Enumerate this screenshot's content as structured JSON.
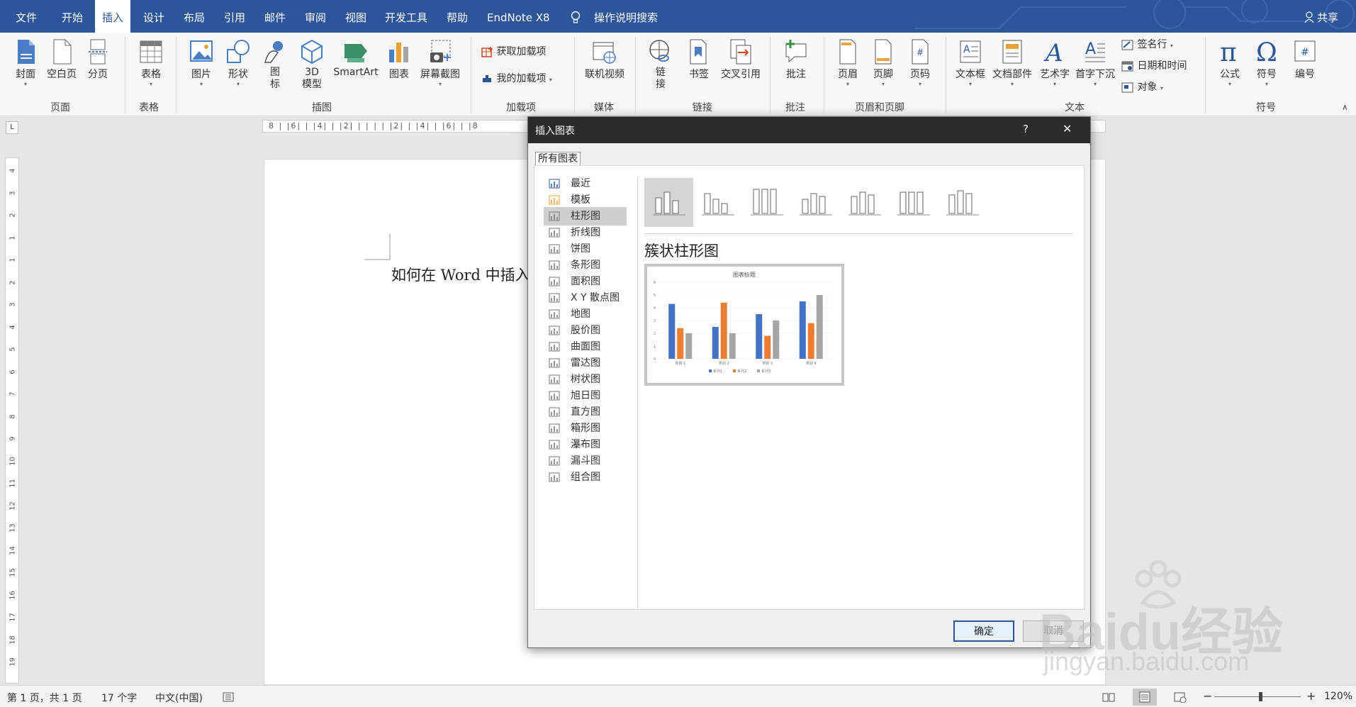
{
  "menubar": {
    "tabs": [
      "文件",
      "开始",
      "插入",
      "设计",
      "布局",
      "引用",
      "邮件",
      "审阅",
      "视图",
      "开发工具",
      "帮助",
      "EndNote X8"
    ],
    "active_tab": "插入",
    "search_label": "操作说明搜索",
    "share_label": "共享"
  },
  "ribbon": {
    "pages_group": {
      "label": "页面",
      "cover": "封面",
      "blank_page": "空白页",
      "page_break": "分页"
    },
    "tables_group": {
      "label": "表格",
      "table": "表格"
    },
    "illustrations_group": {
      "label": "插图",
      "pictures": "图片",
      "shapes": "形状",
      "icons": "图\n标",
      "models_3d": "3D\n模型",
      "smartart": "SmartArt",
      "chart": "图表",
      "screenshot": "屏幕截图"
    },
    "addins_group": {
      "label": "加载项",
      "get_addins": "获取加载项",
      "my_addins": "我的加载项"
    },
    "media_group": {
      "label": "媒体",
      "online_video": "联机视频"
    },
    "links_group": {
      "label": "链接",
      "link": "链\n接",
      "bookmark": "书签",
      "cross_ref": "交叉引用"
    },
    "comments_group": {
      "label": "批注",
      "comment": "批注"
    },
    "header_footer_group": {
      "label": "页眉和页脚",
      "header": "页眉",
      "footer": "页脚",
      "page_number": "页码"
    },
    "text_group": {
      "label": "文本",
      "text_box": "文本框",
      "quick_parts": "文档部件",
      "wordart": "艺术字",
      "drop_cap": "首字下沉",
      "signature_line": "签名行",
      "date_time": "日期和时间",
      "object": "对象"
    },
    "symbols_group": {
      "label": "符号",
      "equation": "公式",
      "symbol": "符号",
      "numbering": "编号"
    }
  },
  "ruler": {
    "horizontal_ticks": "8 | |6| | |4| | |2| | | | | |2| | |4| | |6| | |8",
    "vertical_numbers": [
      "4",
      "3",
      "2",
      "1",
      "1",
      "2",
      "3",
      "4",
      "5",
      "6",
      "7",
      "8",
      "9",
      "10",
      "11",
      "12",
      "13",
      "14",
      "15",
      "16",
      "17",
      "18",
      "19"
    ]
  },
  "document": {
    "text": "如何在 Word 中插入"
  },
  "dialog": {
    "title": "插入图表",
    "help": "?",
    "close": "✕",
    "tab_label": "所有图表",
    "categories": [
      "最近",
      "模板",
      "柱形图",
      "折线图",
      "饼图",
      "条形图",
      "面积图",
      "X Y 散点图",
      "地图",
      "股价图",
      "曲面图",
      "雷达图",
      "树状图",
      "旭日图",
      "直方图",
      "箱形图",
      "瀑布图",
      "漏斗图",
      "组合图"
    ],
    "selected_category": "柱形图",
    "subtype_title": "簇状柱形图",
    "ok_label": "确定",
    "cancel_label": "取消"
  },
  "chart_data": {
    "type": "bar",
    "title": "图表标题",
    "categories": [
      "类别 1",
      "类别 2",
      "类别 3",
      "类别 4"
    ],
    "series": [
      {
        "name": "系列1",
        "values": [
          4.3,
          2.5,
          3.5,
          4.5
        ],
        "color": "#4472c4"
      },
      {
        "name": "系列2",
        "values": [
          2.4,
          4.4,
          1.8,
          2.8
        ],
        "color": "#ed7d31"
      },
      {
        "name": "系列3",
        "values": [
          2,
          2,
          3,
          5
        ],
        "color": "#a5a5a5"
      }
    ],
    "ylim": [
      0,
      6
    ],
    "yticks": [
      "0",
      "1",
      "2",
      "3",
      "4",
      "5",
      "6"
    ],
    "grid": true,
    "legend_position": "bottom"
  },
  "statusbar": {
    "page_info": "第 1 页，共 1 页",
    "word_count": "17 个字",
    "language": "中文(中国)",
    "zoom": "120%"
  },
  "watermark": {
    "brand": "Baidu经验",
    "url": "jingyan.baidu.com"
  }
}
